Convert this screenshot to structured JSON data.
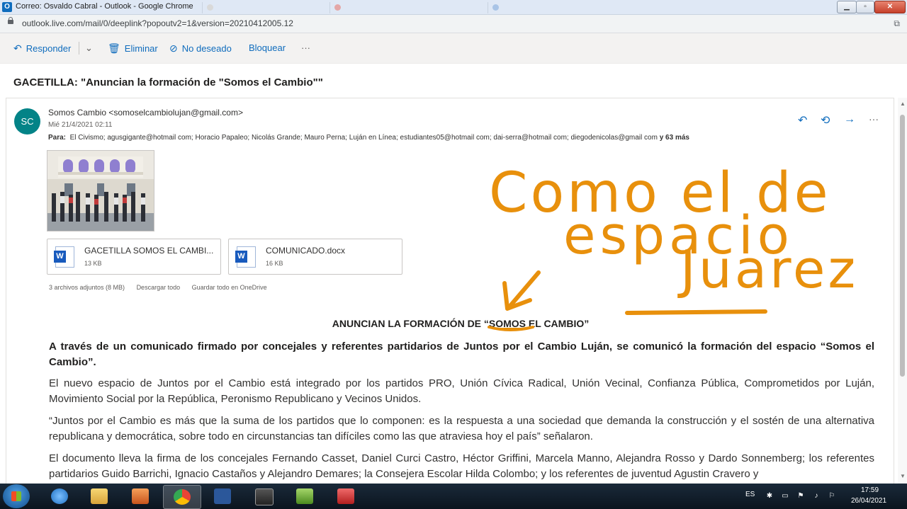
{
  "window": {
    "title": "Correo: Osvaldo Cabral - Outlook - Google Chrome",
    "minimize": "▁",
    "maximize": "▫",
    "close": "✕"
  },
  "address": {
    "url": "outlook.live.com/mail/0/deeplink?popoutv2=1&version=20210412005.12"
  },
  "toolbar": {
    "reply": "Responder",
    "delete": "Eliminar",
    "junk": "No deseado",
    "block": "Bloquear",
    "more": "···"
  },
  "email": {
    "subject": "GACETILLA: \"Anuncian la formación de \"Somos el Cambio\"\"",
    "avatar_initials": "SC",
    "avatar_color": "#038387",
    "sender": "Somos Cambio <somoselcambiolujan@gmail.com>",
    "date": "Mié 21/4/2021 02:11",
    "to_label": "Para:",
    "to": "El Civismo; agusgigante@hotmail com; Horacio Papaleo; Nicolás Grande; Mauro Perna; Luján en Línea; estudiantes05@hotmail com; dai-serra@hotmail com; diegodenicolas@gmail com",
    "to_more": "y 63 más",
    "attachments": [
      {
        "name": "GACETILLA SOMOS EL CAMBI...",
        "size": "13 KB"
      },
      {
        "name": "COMUNICADO.docx",
        "size": "16 KB"
      }
    ],
    "attachments_summary": "3 archivos adjuntos (8 MB)",
    "download_all": "Descargar todo",
    "save_onedrive": "Guardar todo en OneDrive",
    "heading_pre": "ANUNCIAN LA FORMACIÓN DE “",
    "heading_underlined": "SOMOS",
    "heading_post": " EL CAMBIO”",
    "lead": "A través de un comunicado firmado por concejales y referentes partidarios de Juntos por el Cambio Luján, se comunicó la formación del espacio “Somos el Cambio”.",
    "paragraphs": [
      "El nuevo espacio de Juntos por el Cambio está integrado por los partidos PRO, Unión Cívica Radical, Unión Vecinal, Confianza Pública, Comprometidos por Luján, Movimiento Social por la República, Peronismo Republicano y Vecinos Unidos.",
      "“Juntos por el Cambio es más que la suma de los partidos que lo componen: es la respuesta a una sociedad que demanda la construcción y el sostén de una alternativa republicana y democrática, sobre todo en circunstancias tan difíciles como las que atraviesa hoy el país” señalaron.",
      "El documento lleva la firma de los concejales Fernando Casset, Daniel Curci Castro, Héctor Griffini, Marcela Manno, Alejandra Rosso y Dardo Sonnemberg; los referentes partidarios Guido Barrichi, Ignacio Castaños y Alejandro Demares; la Consejera Escolar Hilda Colombo; y los referentes de juventud Agustin Cravero y"
    ]
  },
  "annotation": {
    "line1": "Como el de",
    "line2": "espacio",
    "line3": "Juarez",
    "color": "#e8900c"
  },
  "taskbar": {
    "lang": "ES",
    "time": "17:59",
    "date": "26/04/2021"
  }
}
